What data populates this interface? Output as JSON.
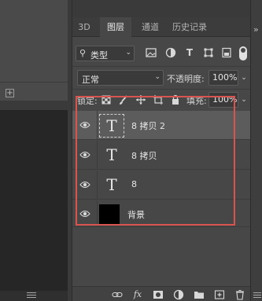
{
  "tabs": [
    {
      "label": "3D",
      "active": false
    },
    {
      "label": "图层",
      "active": true
    },
    {
      "label": "通道",
      "active": false
    },
    {
      "label": "历史记录",
      "active": false
    }
  ],
  "filter": {
    "label": "类型",
    "icons": [
      "image-filter-icon",
      "adjustment-filter-icon",
      "type-filter-icon",
      "shape-filter-icon",
      "smart-object-filter-icon"
    ]
  },
  "blend": {
    "mode": "正常",
    "opacity_label": "不透明度:",
    "opacity_value": "100%"
  },
  "lock": {
    "label": "锁定:",
    "fill_label": "填充:",
    "fill_value": "100%"
  },
  "layers": [
    {
      "name": "8 拷贝 2",
      "kind": "text",
      "thumb": "T",
      "selected": true,
      "visible": true
    },
    {
      "name": "8 拷贝",
      "kind": "text",
      "thumb": "T",
      "selected": false,
      "visible": true
    },
    {
      "name": "8",
      "kind": "text",
      "thumb": "T",
      "selected": false,
      "visible": true
    },
    {
      "name": "背景",
      "kind": "background",
      "thumb": "",
      "selected": false,
      "visible": true
    }
  ],
  "colors": {
    "highlight": "#d9534f",
    "panel_bg": "#474747",
    "selected_row": "#5c5c5c"
  },
  "bottom_icons": [
    "link-icon",
    "fx-icon",
    "mask-icon",
    "adjustment-icon",
    "group-icon",
    "new-layer-icon",
    "trash-icon"
  ]
}
